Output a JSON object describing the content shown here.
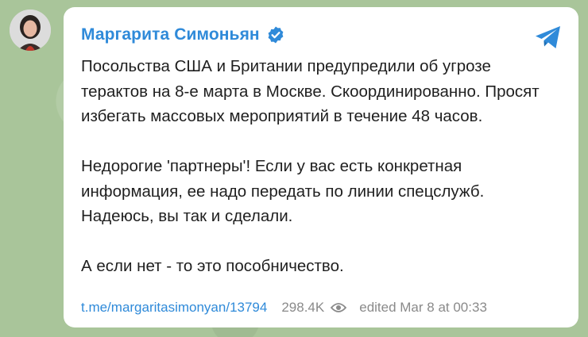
{
  "post": {
    "author": "Маргарита Симоньян",
    "paragraphs": [
      "Посольства США и Британии предупредили об угрозе терактов на 8-е марта в Москве. Скоординированно. Просят избегать массовых мероприятий в течение 48 часов.",
      "Недорогие 'партнеры'! Если у вас есть конкретная информация, ее надо передать по линии спецслужб. Надеюсь, вы так и сделали.",
      "А если нет - то это пособничество."
    ],
    "link_text": "t.me/margaritasimonyan/13794",
    "views": "298.4K",
    "edited_time": "edited Mar 8 at 00:33"
  },
  "colors": {
    "accent": "#2f8ad9",
    "background": "#a9c59a"
  },
  "icons": [
    "verified-icon",
    "telegram-share-icon",
    "eye-icon",
    "avatar"
  ]
}
